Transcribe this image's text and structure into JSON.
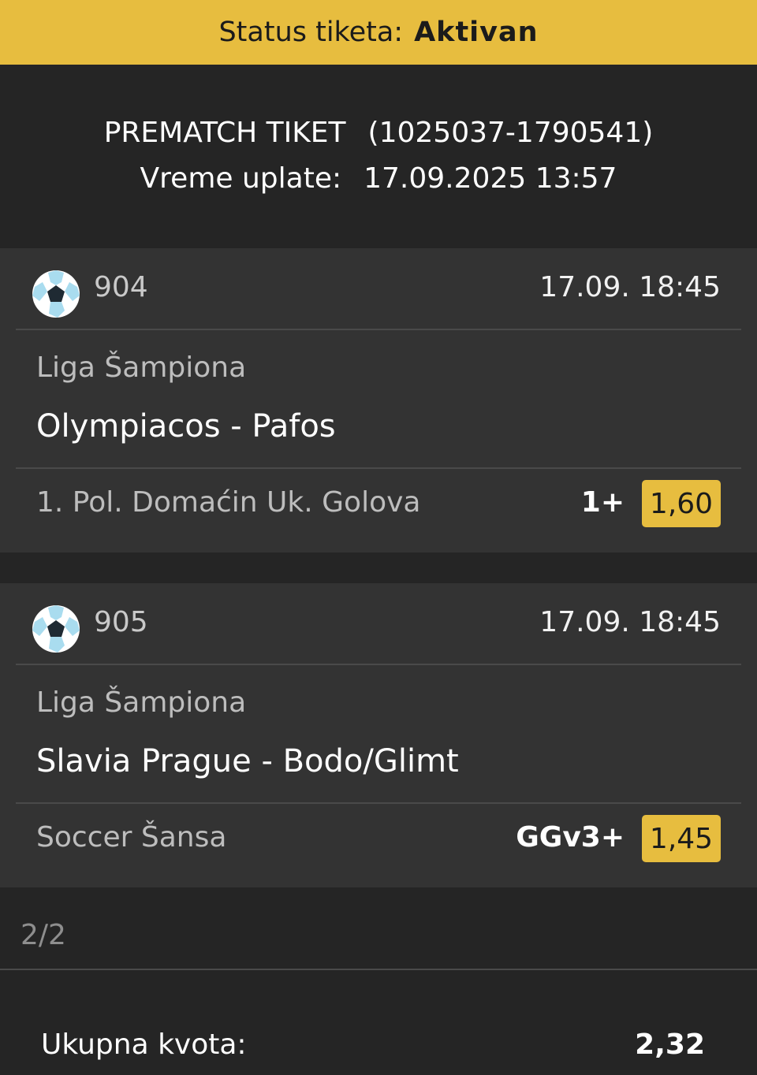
{
  "status": {
    "label": "Status tiketa:",
    "value": "Aktivan"
  },
  "ticket": {
    "type": "PREMATCH TIKET",
    "id": "(1025037-1790541)",
    "paid_label": "Vreme uplate:",
    "paid_time": "17.09.2025 13:57"
  },
  "bets": [
    {
      "code": "904",
      "time": "17.09. 18:45",
      "league": "Liga Šampiona",
      "match": "Olympiacos - Pafos",
      "market": "1. Pol. Domaćin Uk. Golova",
      "pick": "1+",
      "odd": "1,60",
      "icon": "soccer-ball-icon"
    },
    {
      "code": "905",
      "time": "17.09. 18:45",
      "league": "Liga Šampiona",
      "match": "Slavia Prague - Bodo/Glimt",
      "market": "Soccer Šansa",
      "pick": "GGv3+",
      "odd": "1,45",
      "icon": "soccer-ball-icon"
    }
  ],
  "count": "2/2",
  "total": {
    "label": "Ukupna kvota:",
    "value": "2,32"
  },
  "colors": {
    "accent": "#e7bd3f",
    "background": "#252525",
    "card": "#333333"
  }
}
